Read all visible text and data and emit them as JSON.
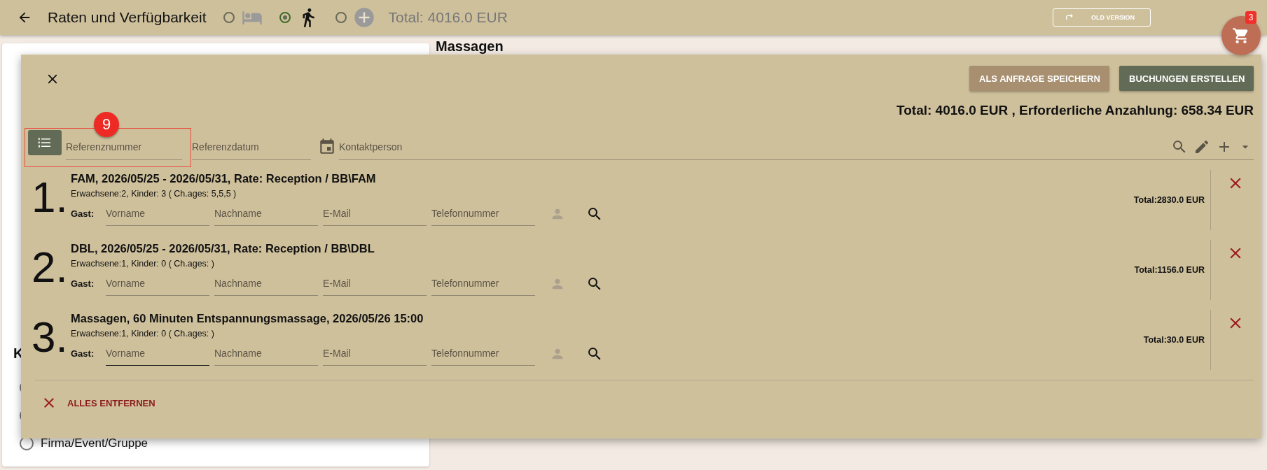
{
  "app_bar": {
    "title": "Raten und Verfügbarkeit",
    "modes": [
      {
        "kind": "bed",
        "selected": false
      },
      {
        "kind": "activity",
        "selected": true
      },
      {
        "kind": "add",
        "selected": false
      }
    ],
    "total": "Total: 4016.0 EUR",
    "old_version_button": "OLD VERSION"
  },
  "cart": {
    "badge": "3"
  },
  "background": {
    "section_heading": "Massagen",
    "left_heading": "K",
    "radios": [
      {
        "kind": "partial",
        "selected": false
      },
      {
        "kind": "partial",
        "selected": false
      },
      {
        "kind": "full",
        "label": "Firma/Event/Gruppe",
        "selected": false
      }
    ]
  },
  "dialog": {
    "buttons": [
      {
        "label": "ALS ANFRAGE SPEICHERN",
        "kind": "secondary"
      },
      {
        "label": "BUCHUNGEN ERSTELLEN",
        "kind": "primary"
      }
    ],
    "summary": "Total: 4016.0 EUR , Erforderliche Anzahlung: 658.34 EUR",
    "step_badge": "9",
    "reference_fields": [
      {
        "placeholder": "Referenznummer"
      },
      {
        "placeholder": "Referenzdatum"
      },
      {
        "placeholder": "Kontaktperson"
      }
    ],
    "bookings": [
      {
        "number": "1.",
        "title": "FAM, 2026/05/25 - 2026/05/31, Rate: Reception / BB\\FAM",
        "guests": "Erwachsene:2, Kinder: 3 ( Ch.ages: 5,5,5 )",
        "guest_label": "Gast:",
        "fields": [
          {
            "placeholder": "Vorname",
            "focused": false
          },
          {
            "placeholder": "Nachname",
            "focused": false
          },
          {
            "placeholder": "E-Mail",
            "focused": false
          },
          {
            "placeholder": "Telefonnummer",
            "focused": false
          }
        ],
        "total": "Total:2830.0 EUR"
      },
      {
        "number": "2.",
        "title": "DBL, 2026/05/25 - 2026/05/31, Rate: Reception / BB\\DBL",
        "guests": "Erwachsene:1, Kinder: 0 ( Ch.ages: )",
        "guest_label": "Gast:",
        "fields": [
          {
            "placeholder": "Vorname",
            "focused": false
          },
          {
            "placeholder": "Nachname",
            "focused": false
          },
          {
            "placeholder": "E-Mail",
            "focused": false
          },
          {
            "placeholder": "Telefonnummer",
            "focused": false
          }
        ],
        "total": "Total:1156.0 EUR"
      },
      {
        "number": "3.",
        "title": "Massagen, 60 Minuten Entspannungsmassage, 2026/05/26 15:00",
        "guests": "Erwachsene:1, Kinder: 0 ( Ch.ages: )",
        "guest_label": "Gast:",
        "fields": [
          {
            "placeholder": "Vorname",
            "focused": true
          },
          {
            "placeholder": "Nachname",
            "focused": false
          },
          {
            "placeholder": "E-Mail",
            "focused": false
          },
          {
            "placeholder": "Telefonnummer",
            "focused": false
          }
        ],
        "total": "Total:30.0 EUR"
      }
    ],
    "remove_all": "ALLES ENTFERNEN"
  }
}
